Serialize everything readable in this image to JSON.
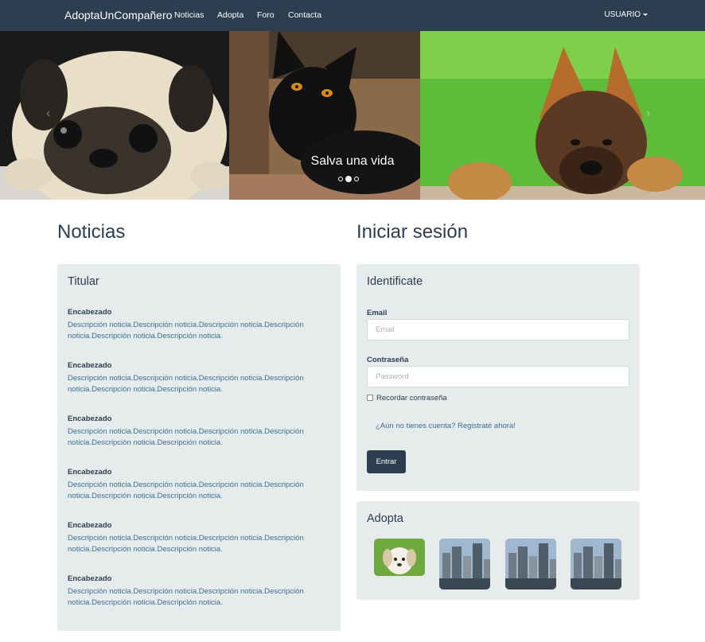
{
  "navbar": {
    "brand": "AdoptaUnCompañero",
    "links": [
      "Noticias",
      "Adopta",
      "Foro",
      "Contacta"
    ],
    "user": "USUARIO"
  },
  "carousel": {
    "caption": "Salva una vida",
    "slide_count": 3,
    "active_slide": 2
  },
  "news": {
    "section_title": "Noticias",
    "panel_title": "Titular",
    "items": [
      {
        "heading": "Encabezado",
        "description": "Descripción noticia.Descripción noticia.Descripción noticia.Descripción noticia.Descripción noticia.Descripción noticia."
      },
      {
        "heading": "Encabezado",
        "description": "Descripción noticia.Descripción noticia.Descripción noticia.Descripción noticia.Descripción noticia.Descripción noticia."
      },
      {
        "heading": "Encabezado",
        "description": "Descripción noticia.Descripción noticia.Descripción noticia.Descripción noticia.Descripción noticia.Descripción noticia."
      },
      {
        "heading": "Encabezado",
        "description": "Descripción noticia.Descripción noticia.Descripción noticia.Descripción noticia.Descripción noticia.Descripción noticia."
      },
      {
        "heading": "Encabezado",
        "description": "Descripción noticia.Descripción noticia.Descripción noticia.Descripción noticia.Descripción noticia.Descripción noticia."
      },
      {
        "heading": "Encabezado",
        "description": "Descripción noticia.Descripción noticia.Descripción noticia.Descripción noticia.Descripción noticia.Descripción noticia."
      }
    ]
  },
  "login": {
    "section_title": "Iniciar sesión",
    "panel_title": "Identificate",
    "email_label": "Email",
    "email_placeholder": "Email",
    "email_value": "",
    "password_label": "Contraseña",
    "password_placeholder": "Password",
    "password_value": "",
    "remember_label": "Recordar contraseña",
    "remember_checked": false,
    "register_link": "¿Aún no tienes cuenta? Registraté ahora!",
    "submit_label": "Entrar"
  },
  "adopt": {
    "panel_title": "Adopta",
    "thumbnails": [
      "puppy-photo",
      "city-photo",
      "city-photo",
      "city-photo"
    ]
  },
  "colors": {
    "primary": "#2c3e50",
    "panel_bg": "#e6ebec",
    "link": "#3e6e93"
  }
}
